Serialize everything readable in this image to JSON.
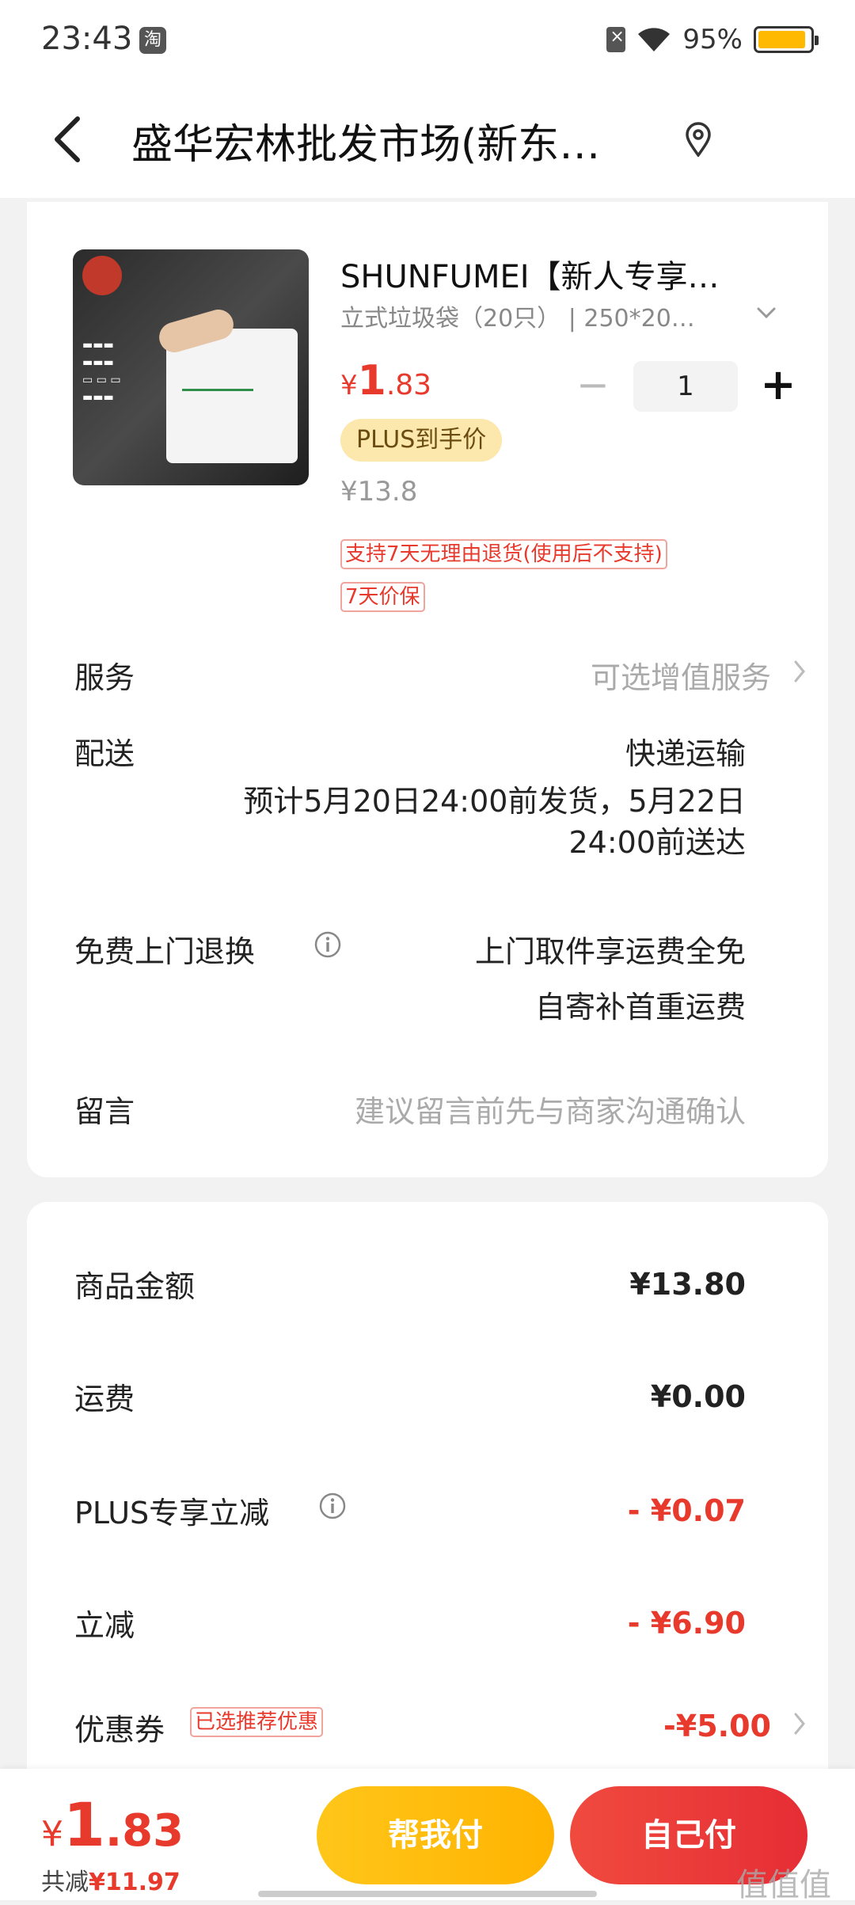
{
  "status_bar": {
    "time": "23:43",
    "app_badge": "淘",
    "battery": "95%"
  },
  "header": {
    "title": "盛华宏林批发市场(新东…"
  },
  "product": {
    "title": "SHUNFUMEI【新人专享…",
    "spec": "立式垃圾袋（20只） | 250*20…",
    "price_symbol": "¥",
    "price_int": "1",
    "price_dec": ".83",
    "quantity": "1",
    "plus_tag": "PLUS到手价",
    "original_price": "¥13.8",
    "tags": [
      "支持7天无理由退货(使用后不支持)",
      "7天价保"
    ]
  },
  "rows": {
    "service_label": "服务",
    "service_value": "可选增值服务",
    "delivery_label": "配送",
    "delivery_method": "快递运输",
    "delivery_line1": "预计5月20日24:00前发货，5月22日",
    "delivery_line2": "24:00前送达",
    "return_label": "免费上门退换",
    "return_line1": "上门取件享运费全免",
    "return_line2": "自寄补首重运费",
    "message_label": "留言",
    "message_placeholder": "建议留言前先与商家沟通确认"
  },
  "fees": {
    "goods_label": "商品金额",
    "goods_value": "¥13.80",
    "shipping_label": "运费",
    "shipping_value": "¥0.00",
    "plus_label": "PLUS专享立减",
    "plus_value": "- ¥0.07",
    "discount_label": "立减",
    "discount_value": "- ¥6.90",
    "coupon_label": "优惠券",
    "coupon_tag": "已选推荐优惠",
    "coupon_value": "-¥5.00"
  },
  "footer": {
    "total_symbol": "¥",
    "total_int": "1",
    "total_dec": ".83",
    "saved_label": "共减",
    "saved_amount": "¥11.97",
    "help_pay": "帮我付",
    "self_pay": "自己付"
  },
  "watermark": "值值值",
  "colors": {
    "accent_red": "#e8392d",
    "accent_yellow": "#ffc61a",
    "plus_tag_bg": "#fce7ac"
  }
}
